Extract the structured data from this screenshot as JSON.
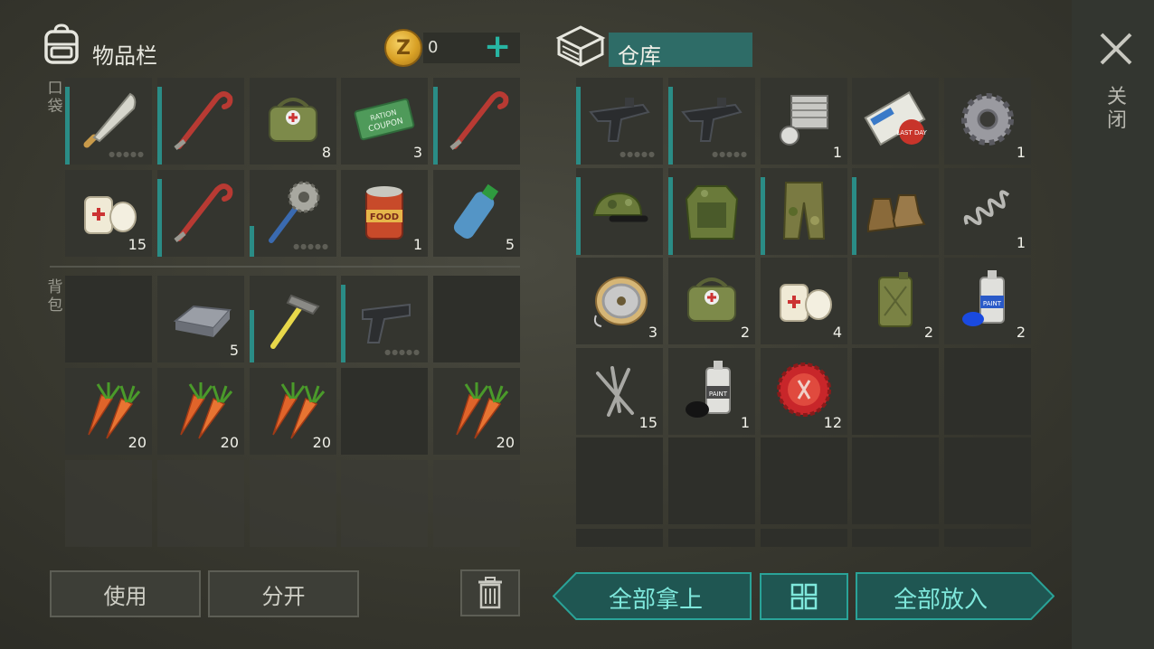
{
  "inventory": {
    "title": "物品栏",
    "coins": "0",
    "pocket_label": "口袋",
    "backpack_label": "背包",
    "pocket_slots": [
      {
        "item": "machete",
        "count": "",
        "durability": 0.9,
        "dots": true
      },
      {
        "item": "crowbar",
        "count": "",
        "durability": 0.9,
        "dots": false
      },
      {
        "item": "medkit-bag",
        "count": "8",
        "durability": null,
        "dots": false
      },
      {
        "item": "ration-coupon",
        "count": "3",
        "durability": null,
        "dots": false
      },
      {
        "item": "crowbar",
        "count": "",
        "durability": 0.9,
        "dots": false
      },
      {
        "item": "bandage",
        "count": "15",
        "durability": null,
        "dots": false
      },
      {
        "item": "crowbar",
        "count": "",
        "durability": 0.9,
        "dots": false
      },
      {
        "item": "saw-mace",
        "count": "",
        "durability": 0.35,
        "dots": true
      },
      {
        "item": "canned-food",
        "count": "1",
        "durability": null,
        "dots": false
      },
      {
        "item": "water-bottle",
        "count": "5",
        "durability": null,
        "dots": false
      }
    ],
    "backpack_slots": [
      {
        "item": "",
        "count": "",
        "durability": null,
        "dots": false
      },
      {
        "item": "iron-ingot",
        "count": "5",
        "durability": null,
        "dots": false
      },
      {
        "item": "hammer",
        "count": "",
        "durability": 0.6,
        "dots": false
      },
      {
        "item": "pistol",
        "count": "",
        "durability": 0.9,
        "dots": true
      },
      {
        "item": "",
        "count": "",
        "durability": null,
        "dots": false
      },
      {
        "item": "carrots",
        "count": "20",
        "durability": null,
        "dots": false
      },
      {
        "item": "carrots",
        "count": "20",
        "durability": null,
        "dots": false
      },
      {
        "item": "carrots",
        "count": "20",
        "durability": null,
        "dots": false
      },
      {
        "item": "",
        "count": "",
        "durability": null,
        "dots": false
      },
      {
        "item": "carrots",
        "count": "20",
        "durability": null,
        "dots": false
      }
    ],
    "locked_slots": 5
  },
  "storage": {
    "title": "仓库",
    "slots": [
      {
        "item": "uzi",
        "count": "",
        "durability": 0.9,
        "dots": true
      },
      {
        "item": "uzi",
        "count": "",
        "durability": 0.9,
        "dots": true
      },
      {
        "item": "engine-cylinder",
        "count": "1",
        "durability": null,
        "dots": false
      },
      {
        "item": "last-day-magazine",
        "count": "",
        "durability": null,
        "dots": false
      },
      {
        "item": "gear",
        "count": "1",
        "durability": null,
        "dots": false
      },
      {
        "item": "camo-cap",
        "count": "",
        "durability": 0.9,
        "dots": false
      },
      {
        "item": "camo-vest",
        "count": "",
        "durability": 0.9,
        "dots": false
      },
      {
        "item": "camo-pants",
        "count": "",
        "durability": 0.9,
        "dots": false
      },
      {
        "item": "boots",
        "count": "",
        "durability": 0.9,
        "dots": false
      },
      {
        "item": "spring",
        "count": "1",
        "durability": null,
        "dots": false
      },
      {
        "item": "wire-spool",
        "count": "3",
        "durability": null,
        "dots": false
      },
      {
        "item": "medkit-bag",
        "count": "2",
        "durability": null,
        "dots": false
      },
      {
        "item": "bandage",
        "count": "4",
        "durability": null,
        "dots": false
      },
      {
        "item": "jerrycan",
        "count": "2",
        "durability": null,
        "dots": false
      },
      {
        "item": "spray-paint-blue",
        "count": "2",
        "durability": null,
        "dots": false
      },
      {
        "item": "nails",
        "count": "15",
        "durability": null,
        "dots": false
      },
      {
        "item": "spray-paint-black",
        "count": "1",
        "durability": null,
        "dots": false
      },
      {
        "item": "bottle-cap",
        "count": "12",
        "durability": null,
        "dots": false
      },
      {
        "item": "",
        "count": "",
        "durability": null,
        "dots": false
      },
      {
        "item": "",
        "count": "",
        "durability": null,
        "dots": false
      },
      {
        "item": "",
        "count": "",
        "durability": null,
        "dots": false
      },
      {
        "item": "",
        "count": "",
        "durability": null,
        "dots": false
      },
      {
        "item": "",
        "count": "",
        "durability": null,
        "dots": false
      },
      {
        "item": "",
        "count": "",
        "durability": null,
        "dots": false
      },
      {
        "item": "",
        "count": "",
        "durability": null,
        "dots": false
      },
      {
        "item": "",
        "count": "",
        "durability": null,
        "dots": false
      },
      {
        "item": "",
        "count": "",
        "durability": null,
        "dots": false
      },
      {
        "item": "",
        "count": "",
        "durability": null,
        "dots": false
      },
      {
        "item": "",
        "count": "",
        "durability": null,
        "dots": false
      },
      {
        "item": "",
        "count": "",
        "durability": null,
        "dots": false
      }
    ]
  },
  "buttons": {
    "use": "使用",
    "split": "分开",
    "take_all": "全部拿上",
    "put_all": "全部放入",
    "close": "关闭"
  },
  "colors": {
    "accent": "#2aa398",
    "durability": "#2a8c86",
    "coin": "#d9a126"
  }
}
